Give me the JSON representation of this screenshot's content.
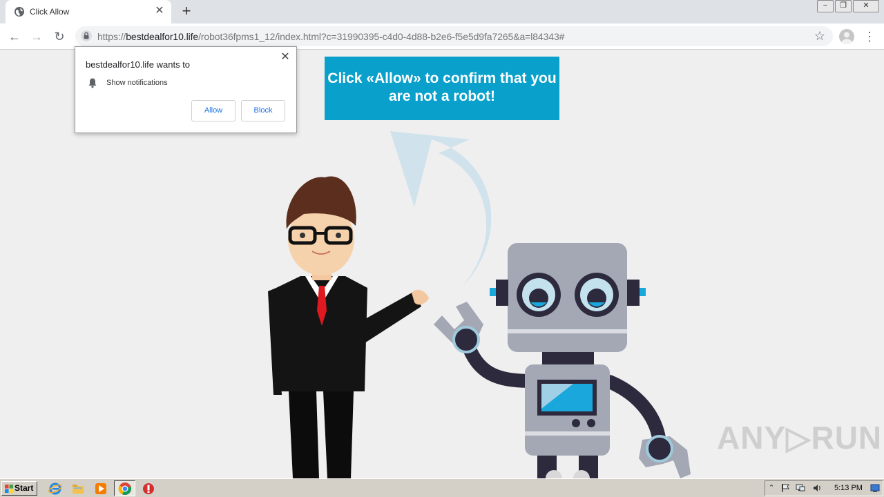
{
  "browser": {
    "tab_title": "Click Allow",
    "tab_close": "✕",
    "new_tab": "+",
    "url_scheme": "https://",
    "url_host": "bestdealfor10.life",
    "url_path": "/robot36fpms1_12/index.html?c=31990395-c4d0-4d88-b2e6-f5e5d9fa7265&a=l84343#",
    "back_glyph": "←",
    "forward_glyph": "→",
    "reload_glyph": "↻",
    "star_glyph": "☆",
    "menu_glyph": "⋮",
    "win_min": "−",
    "win_max": "❐",
    "win_close": "✕"
  },
  "page": {
    "banner_text": "Click «Allow» to confirm that you are not a robot!",
    "banner_color": "#0aa0cc",
    "watermark": "ANY▷RUN"
  },
  "permission_popup": {
    "title": "bestdealfor10.life wants to",
    "close": "✕",
    "item_label": "Show notifications",
    "allow_label": "Allow",
    "block_label": "Block"
  },
  "taskbar": {
    "start_label": "Start",
    "clock": "5:13 PM"
  }
}
